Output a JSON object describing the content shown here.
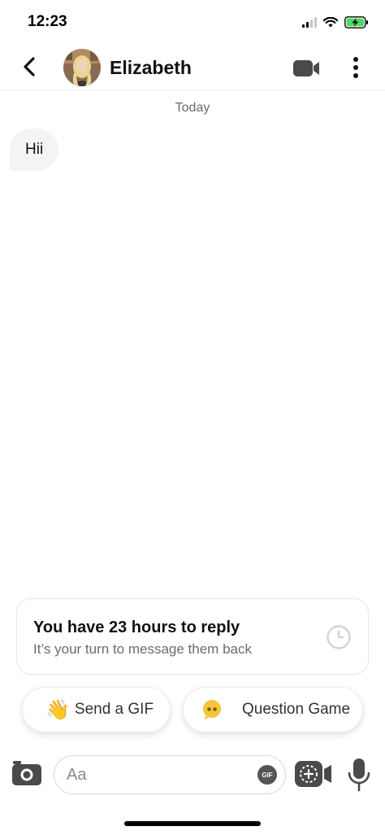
{
  "status_bar": {
    "time": "12:23",
    "icons": [
      "signal-icon",
      "wifi-icon",
      "battery-charging-icon"
    ],
    "battery_color": "#4cd964"
  },
  "header": {
    "back_icon": "chevron-left-icon",
    "contact_name": "Elizabeth",
    "video_call_icon": "video-camera-icon",
    "more_icon": "vertical-ellipsis-icon"
  },
  "conversation": {
    "date_separator": "Today",
    "messages": [
      {
        "from": "contact",
        "text": "Hii"
      }
    ]
  },
  "reply_prompt": {
    "title": "You have 23 hours to reply",
    "subtitle": "It’s your turn to message them back",
    "icon": "clock-icon"
  },
  "actions": {
    "send_gif": {
      "emoji": "👋",
      "label": "Send a GIF"
    },
    "question_game": {
      "icon": "question-game-icon",
      "label": "Question Game",
      "icon_color": "#f5c43c"
    }
  },
  "composer": {
    "placeholder": "Aa",
    "value": "",
    "gif_badge": "GIF",
    "camera_icon": "camera-icon",
    "video_note_icon": "video-note-icon",
    "mic_icon": "microphone-icon"
  }
}
